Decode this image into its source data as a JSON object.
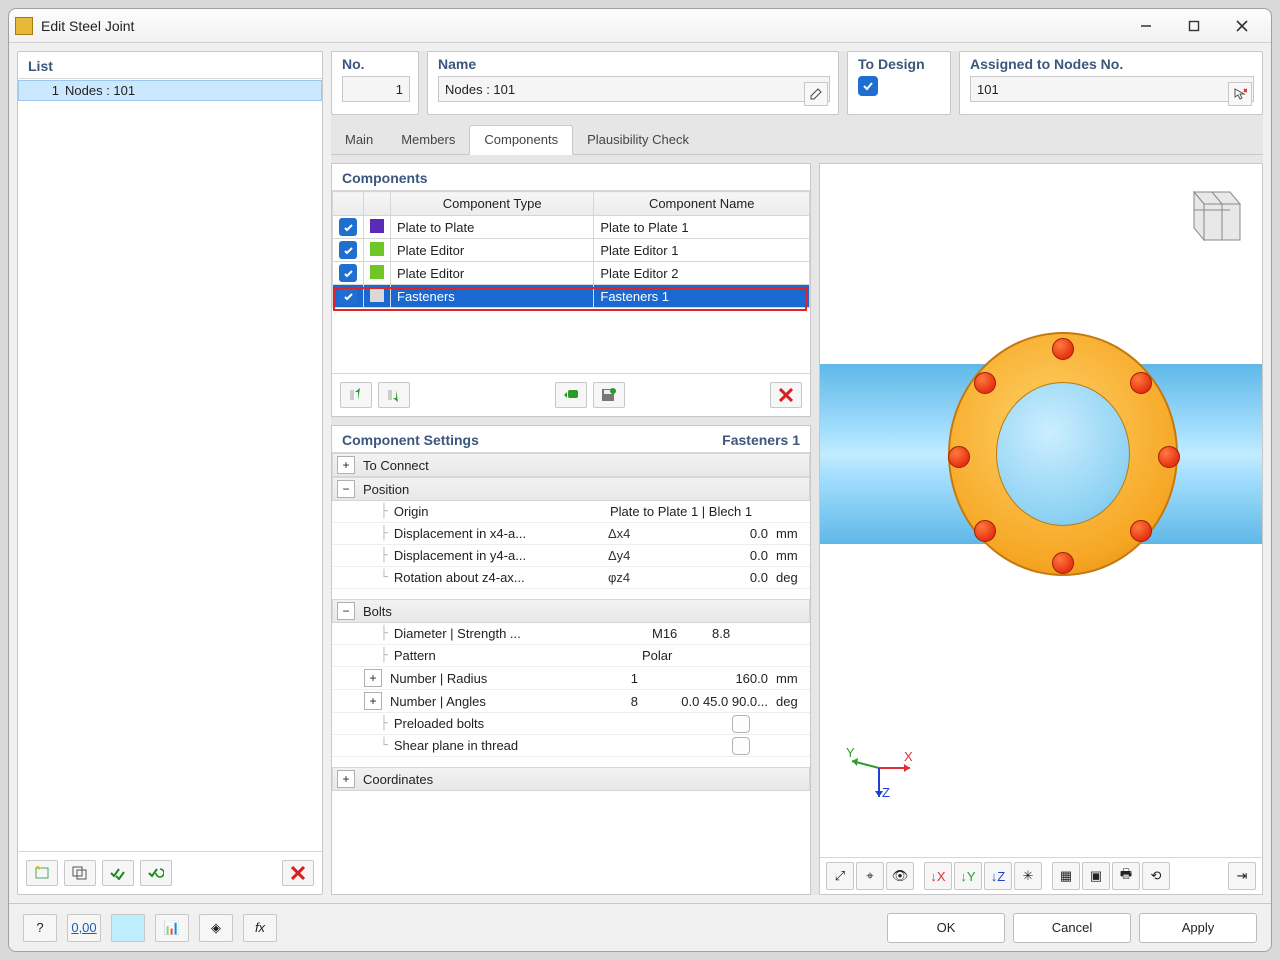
{
  "window": {
    "title": "Edit Steel Joint"
  },
  "list": {
    "title": "List",
    "items": [
      {
        "index": "1",
        "label": "Nodes : 101"
      }
    ]
  },
  "header": {
    "no_label": "No.",
    "no_value": "1",
    "name_label": "Name",
    "name_value": "Nodes : 101",
    "todesign_label": "To Design",
    "assigned_label": "Assigned to Nodes No.",
    "assigned_value": "101"
  },
  "tabs": [
    "Main",
    "Members",
    "Components",
    "Plausibility Check"
  ],
  "active_tab": "Components",
  "components": {
    "title": "Components",
    "columns": [
      "Component Type",
      "Component Name"
    ],
    "rows": [
      {
        "enabled": true,
        "color": "#5a2ab8",
        "type": "Plate to Plate",
        "name": "Plate to Plate 1"
      },
      {
        "enabled": true,
        "color": "#6fc727",
        "type": "Plate Editor",
        "name": "Plate Editor 1"
      },
      {
        "enabled": true,
        "color": "#6fc727",
        "type": "Plate Editor",
        "name": "Plate Editor 2"
      },
      {
        "enabled": true,
        "color": "#d9d9d9",
        "type": "Fasteners",
        "name": "Fasteners 1",
        "selected": true
      }
    ]
  },
  "settings": {
    "title": "Component Settings",
    "subtitle": "Fasteners 1",
    "groups": {
      "to_connect": "To Connect",
      "position": "Position",
      "bolts": "Bolts",
      "coordinates": "Coordinates"
    },
    "position": {
      "origin_label": "Origin",
      "origin_value": "Plate to Plate 1 | Blech 1",
      "dx_label": "Displacement in x4-a...",
      "dx_sym": "Δx4",
      "dx_val": "0.0",
      "dx_unit": "mm",
      "dy_label": "Displacement in y4-a...",
      "dy_sym": "Δy4",
      "dy_val": "0.0",
      "dy_unit": "mm",
      "rz_label": "Rotation about z4-ax...",
      "rz_sym": "φz4",
      "rz_val": "0.0",
      "rz_unit": "deg"
    },
    "bolts": {
      "dia_label": "Diameter | Strength ...",
      "dia_v1": "M16",
      "dia_v2": "8.8",
      "pattern_label": "Pattern",
      "pattern_val": "Polar",
      "numrad_label": "Number | Radius",
      "numrad_v1": "1",
      "numrad_v2": "160.0",
      "numrad_unit": "mm",
      "numang_label": "Number | Angles",
      "numang_v1": "8",
      "numang_v2": "0.0 45.0 90.0...",
      "numang_unit": "deg",
      "preloaded_label": "Preloaded bolts",
      "shear_label": "Shear plane in thread"
    }
  },
  "buttons": {
    "ok": "OK",
    "cancel": "Cancel",
    "apply": "Apply"
  },
  "axis_labels": {
    "x": "X",
    "y": "Y",
    "z": "Z"
  }
}
